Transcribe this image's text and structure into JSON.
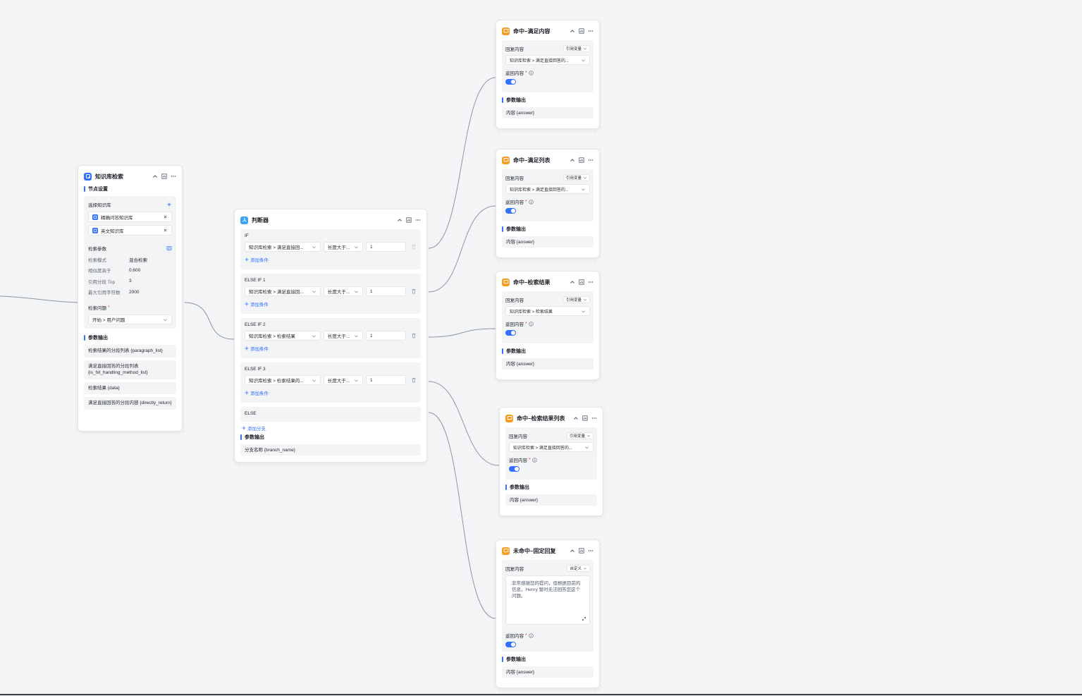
{
  "kb_node": {
    "title": "知识库检索",
    "settings_title": "节点设置",
    "select_kb_label": "选择知识库",
    "kbs": [
      "精确问答知识库",
      "英文知识库"
    ],
    "params_label": "检索参数",
    "params": [
      {
        "k": "检索模式",
        "v": "混合检索"
      },
      {
        "k": "相似度高于",
        "v": "0.600"
      },
      {
        "k": "引用分段 Top",
        "v": "3"
      },
      {
        "k": "最大引用字符数",
        "v": "2000"
      }
    ],
    "question_label": "检索问题",
    "question_value": "开始 > 用户问题",
    "output_title": "参数输出",
    "outputs": [
      "检索结果的分段列表 {paragraph_list}",
      "满足直接回答的分段列表 {is_hit_handling_method_list}",
      "检索结果 {data}",
      "满足直接回答的分段内容 {directly_return}"
    ]
  },
  "cond_node": {
    "title": "判断器",
    "branches": [
      {
        "label": "IF",
        "field": "知识库检索 > 满足直接回...",
        "op": "长度大于...",
        "value": "1",
        "add": "添加条件"
      },
      {
        "label": "ELSE IF 1",
        "field": "知识库检索 > 满足直接回...",
        "op": "长度大于...",
        "value": "1",
        "add": "添加条件"
      },
      {
        "label": "ELSE IF 2",
        "field": "知识库检索 > 检索结果",
        "op": "长度大于...",
        "value": "1",
        "add": "添加条件"
      },
      {
        "label": "ELSE IF 3",
        "field": "知识库检索 > 检索结果的...",
        "op": "长度大于...",
        "value": "1",
        "add": "添加条件"
      }
    ],
    "else_label": "ELSE",
    "add_branch": "添加分支",
    "output_title": "参数输出",
    "output": "分支名称 {branch_name}"
  },
  "reply_nodes": [
    {
      "title": "命中–满足内容",
      "reply_label": "回复内容",
      "mode": "引用变量",
      "value": "知识库检索 > 满足直接回答的...",
      "return_label": "返回内容",
      "output_title": "参数输出",
      "output": "内容 {answer}"
    },
    {
      "title": "命中–满足列表",
      "reply_label": "回复内容",
      "mode": "引用变量",
      "value": "知识库检索 > 满足直接回答的...",
      "return_label": "返回内容",
      "output_title": "参数输出",
      "output": "内容 {answer}"
    },
    {
      "title": "命中–检索结果",
      "reply_label": "回复内容",
      "mode": "引用变量",
      "value": "知识库检索 > 检索结果",
      "return_label": "返回内容",
      "output_title": "参数输出",
      "output": "内容 {answer}"
    },
    {
      "title": "命中–检索结果列表",
      "reply_label": "回复内容",
      "mode": "引用变量",
      "value": "知识库检索 > 满足直接回答的...",
      "return_label": "返回内容",
      "output_title": "参数输出",
      "output": "内容 {answer}"
    }
  ],
  "fixed_node": {
    "title": "未命中–固定回复",
    "reply_label": "回复内容",
    "mode": "自定义",
    "text": "非常感谢您的提问，但根据目前的信息，Henry 暂时无法回答您这个问题。",
    "return_label": "返回内容",
    "output_title": "参数输出",
    "output": "内容 {answer}"
  },
  "colors": {
    "accent": "#3370ff",
    "reply_icon": "#f79b1f",
    "cond_icon": "#3ba2f5"
  }
}
